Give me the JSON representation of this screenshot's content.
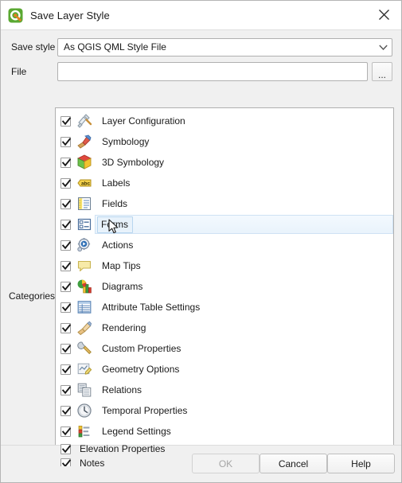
{
  "window": {
    "title": "Save Layer Style",
    "logo_icon": "qgis-logo-icon",
    "close_icon": "close-icon"
  },
  "form": {
    "save_style": {
      "label": "Save style",
      "value": "As QGIS QML Style File",
      "arrow_icon": "chevron-down-icon"
    },
    "file": {
      "label": "File",
      "value": "",
      "placeholder": "",
      "browse_label": "...",
      "browse_icon": "ellipsis-icon"
    },
    "categories_label": "Categories"
  },
  "categories": [
    {
      "label": "Layer Configuration",
      "checked": true,
      "icon": "layer-configuration-icon",
      "compact": false,
      "selected": false
    },
    {
      "label": "Symbology",
      "checked": true,
      "icon": "symbology-icon",
      "compact": false,
      "selected": false
    },
    {
      "label": "3D Symbology",
      "checked": true,
      "icon": "3d-symbology-icon",
      "compact": false,
      "selected": false
    },
    {
      "label": "Labels",
      "checked": true,
      "icon": "labels-icon",
      "compact": false,
      "selected": false
    },
    {
      "label": "Fields",
      "checked": true,
      "icon": "fields-icon",
      "compact": false,
      "selected": false
    },
    {
      "label": "Forms",
      "checked": true,
      "icon": "forms-icon",
      "compact": false,
      "selected": true
    },
    {
      "label": "Actions",
      "checked": true,
      "icon": "actions-icon",
      "compact": false,
      "selected": false
    },
    {
      "label": "Map Tips",
      "checked": true,
      "icon": "map-tips-icon",
      "compact": false,
      "selected": false
    },
    {
      "label": "Diagrams",
      "checked": true,
      "icon": "diagrams-icon",
      "compact": false,
      "selected": false
    },
    {
      "label": "Attribute Table Settings",
      "checked": true,
      "icon": "attribute-table-settings-icon",
      "compact": false,
      "selected": false
    },
    {
      "label": "Rendering",
      "checked": true,
      "icon": "rendering-icon",
      "compact": false,
      "selected": false
    },
    {
      "label": "Custom Properties",
      "checked": true,
      "icon": "custom-properties-icon",
      "compact": false,
      "selected": false
    },
    {
      "label": "Geometry Options",
      "checked": true,
      "icon": "geometry-options-icon",
      "compact": false,
      "selected": false
    },
    {
      "label": "Relations",
      "checked": true,
      "icon": "relations-icon",
      "compact": false,
      "selected": false
    },
    {
      "label": "Temporal Properties",
      "checked": true,
      "icon": "temporal-properties-icon",
      "compact": false,
      "selected": false
    },
    {
      "label": "Legend Settings",
      "checked": true,
      "icon": "legend-settings-icon",
      "compact": false,
      "selected": false
    },
    {
      "label": "Elevation Properties",
      "checked": true,
      "icon": null,
      "compact": true,
      "selected": false
    },
    {
      "label": "Notes",
      "checked": true,
      "icon": null,
      "compact": true,
      "selected": false
    }
  ],
  "footer": {
    "ok_label": "OK",
    "ok_enabled": false,
    "cancel_label": "Cancel",
    "help_label": "Help"
  },
  "colors": {
    "dialog_bg": "#f0f0f0",
    "titlebar_bg": "#ffffff",
    "list_bg": "#ffffff",
    "selection_bg": "#e9f3fc",
    "selection_border": "#b8d6ef",
    "brand_green": "#5aa832",
    "brand_orange": "#e77e23",
    "disabled_text": "#a6a6a6"
  }
}
